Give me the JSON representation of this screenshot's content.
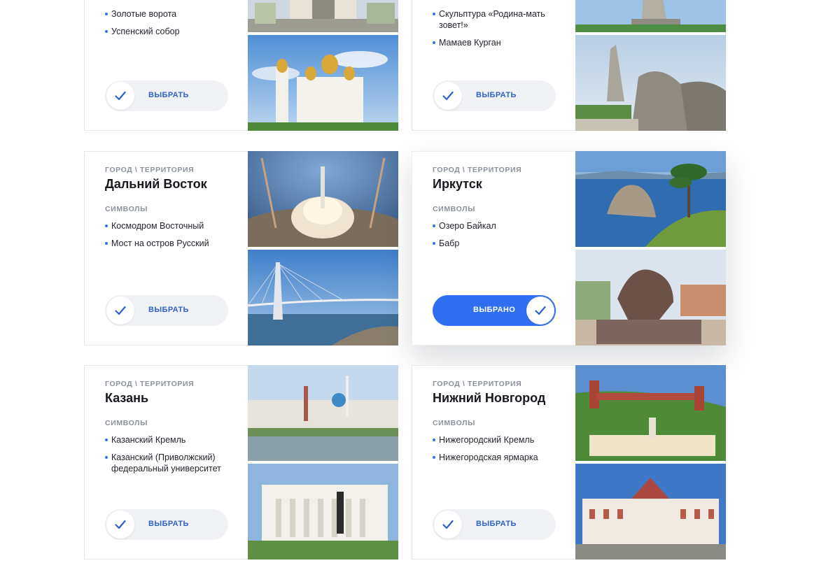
{
  "cards": [
    {
      "kicker": "",
      "title": "",
      "symbols_label": "",
      "symbols": [
        "Золотые ворота",
        "Успенский собор"
      ],
      "button": "ВЫБРАТЬ",
      "selected": false,
      "photos": [
        "golden-gate-vladimir-photo",
        "assumption-cathedral-photo"
      ]
    },
    {
      "kicker": "",
      "title": "",
      "symbols_label": "",
      "symbols": [
        "Скульптура «Родина-мать зовет!»",
        "Мамаев Курган"
      ],
      "button": "ВЫБРАТЬ",
      "selected": false,
      "photos": [
        "motherland-calls-photo",
        "mamayev-kurgan-photo"
      ]
    },
    {
      "kicker": "ГОРОД \\ ТЕРРИТОРИЯ",
      "title": "Дальний Восток",
      "symbols_label": "СИМВОЛЫ",
      "symbols": [
        "Космодром Восточный",
        "Мост на остров Русский"
      ],
      "button": "ВЫБРАТЬ",
      "selected": false,
      "photos": [
        "vostochny-launch-photo",
        "russky-bridge-photo"
      ]
    },
    {
      "kicker": "ГОРОД \\ ТЕРРИТОРИЯ",
      "title": "Иркутск",
      "symbols_label": "СИМВОЛЫ",
      "symbols": [
        "Озеро Байкал",
        "Бабр"
      ],
      "button": "ВЫБРАНО",
      "selected": true,
      "photos": [
        "baikal-lake-photo",
        "babr-statue-photo"
      ]
    },
    {
      "kicker": "ГОРОД \\ ТЕРРИТОРИЯ",
      "title": "Казань",
      "symbols_label": "СИМВОЛЫ",
      "symbols": [
        "Казанский Кремль",
        "Казанский (Приволжский) федеральный университет"
      ],
      "button": "ВЫБРАТЬ",
      "selected": false,
      "photos": [
        "kazan-kremlin-photo",
        "kazan-university-photo"
      ]
    },
    {
      "kicker": "ГОРОД \\ ТЕРРИТОРИЯ",
      "title": "Нижний Новгород",
      "symbols_label": "СИМВОЛЫ",
      "symbols": [
        "Нижегородский Кремль",
        "Нижегородская ярмарка"
      ],
      "button": "ВЫБРАТЬ",
      "selected": false,
      "photos": [
        "nizhny-kremlin-photo",
        "nizhny-fair-photo"
      ]
    }
  ],
  "colors": {
    "accent": "#2f6ef0",
    "button_text": "#2f62c9",
    "button_bg": "#f0f2f5",
    "muted": "#8a919c"
  },
  "icons": {
    "button": "check-icon",
    "bullet": "bullet-dot"
  }
}
